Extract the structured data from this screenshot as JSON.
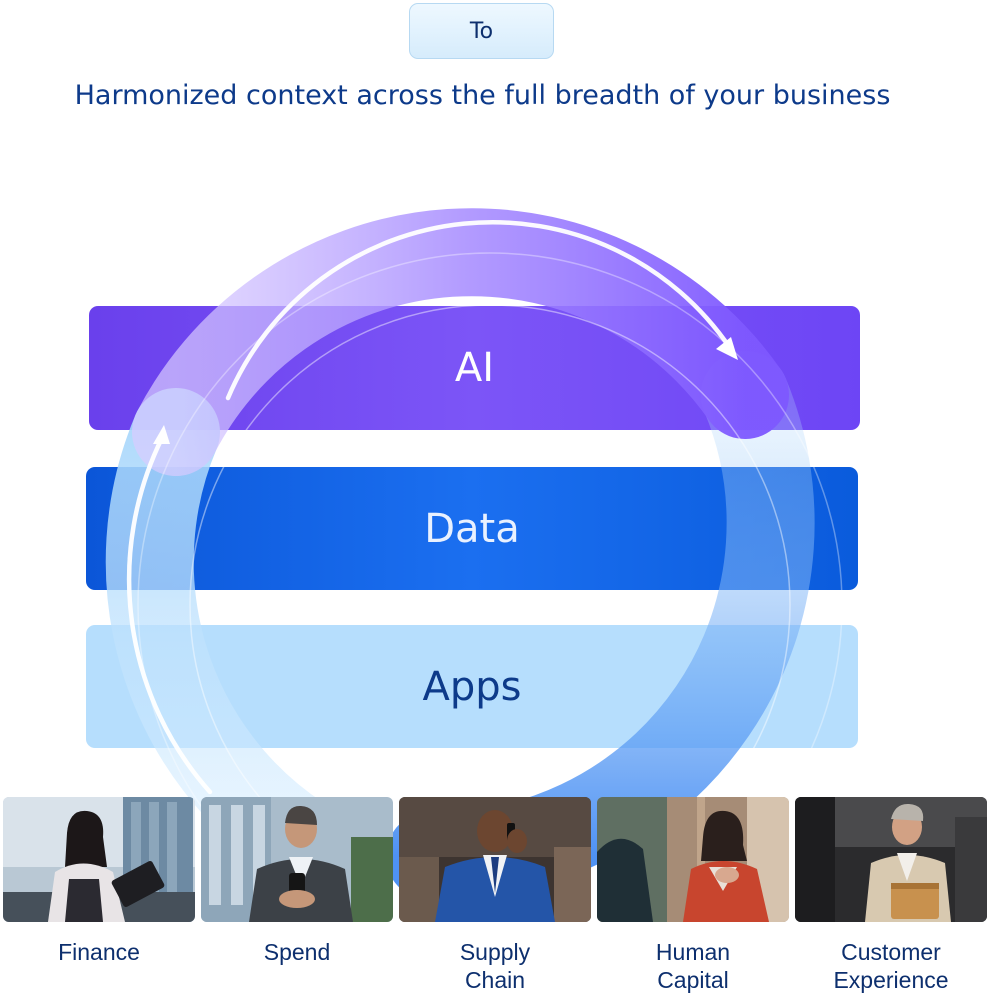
{
  "top_pill": {
    "label": "To"
  },
  "headline": "Harmonized context across the full breadth of your business",
  "layers": [
    {
      "id": "ai",
      "label": "AI",
      "color": "#6d45f5"
    },
    {
      "id": "data",
      "label": "Data",
      "color": "#0b5cdc"
    },
    {
      "id": "apps",
      "label": "Apps",
      "color": "#b6defd"
    }
  ],
  "ring": {
    "direction": "clockwise",
    "colors": {
      "purple": "#8a63ff",
      "light_blue": "#a9d8fb",
      "blue": "#4d8ff5"
    }
  },
  "functions": [
    {
      "id": "finance",
      "lines": [
        "Finance"
      ],
      "photo_icon": "person-with-tablet"
    },
    {
      "id": "spend",
      "lines": [
        "Spend"
      ],
      "photo_icon": "person-with-phone"
    },
    {
      "id": "supply-chain",
      "lines": [
        "Supply",
        "Chain"
      ],
      "photo_icon": "person-on-call"
    },
    {
      "id": "human-capital",
      "lines": [
        "Human",
        "Capital"
      ],
      "photo_icon": "two-people-talking"
    },
    {
      "id": "customer-experience",
      "lines": [
        "Customer",
        "Experience"
      ],
      "photo_icon": "person-with-folder"
    }
  ]
}
